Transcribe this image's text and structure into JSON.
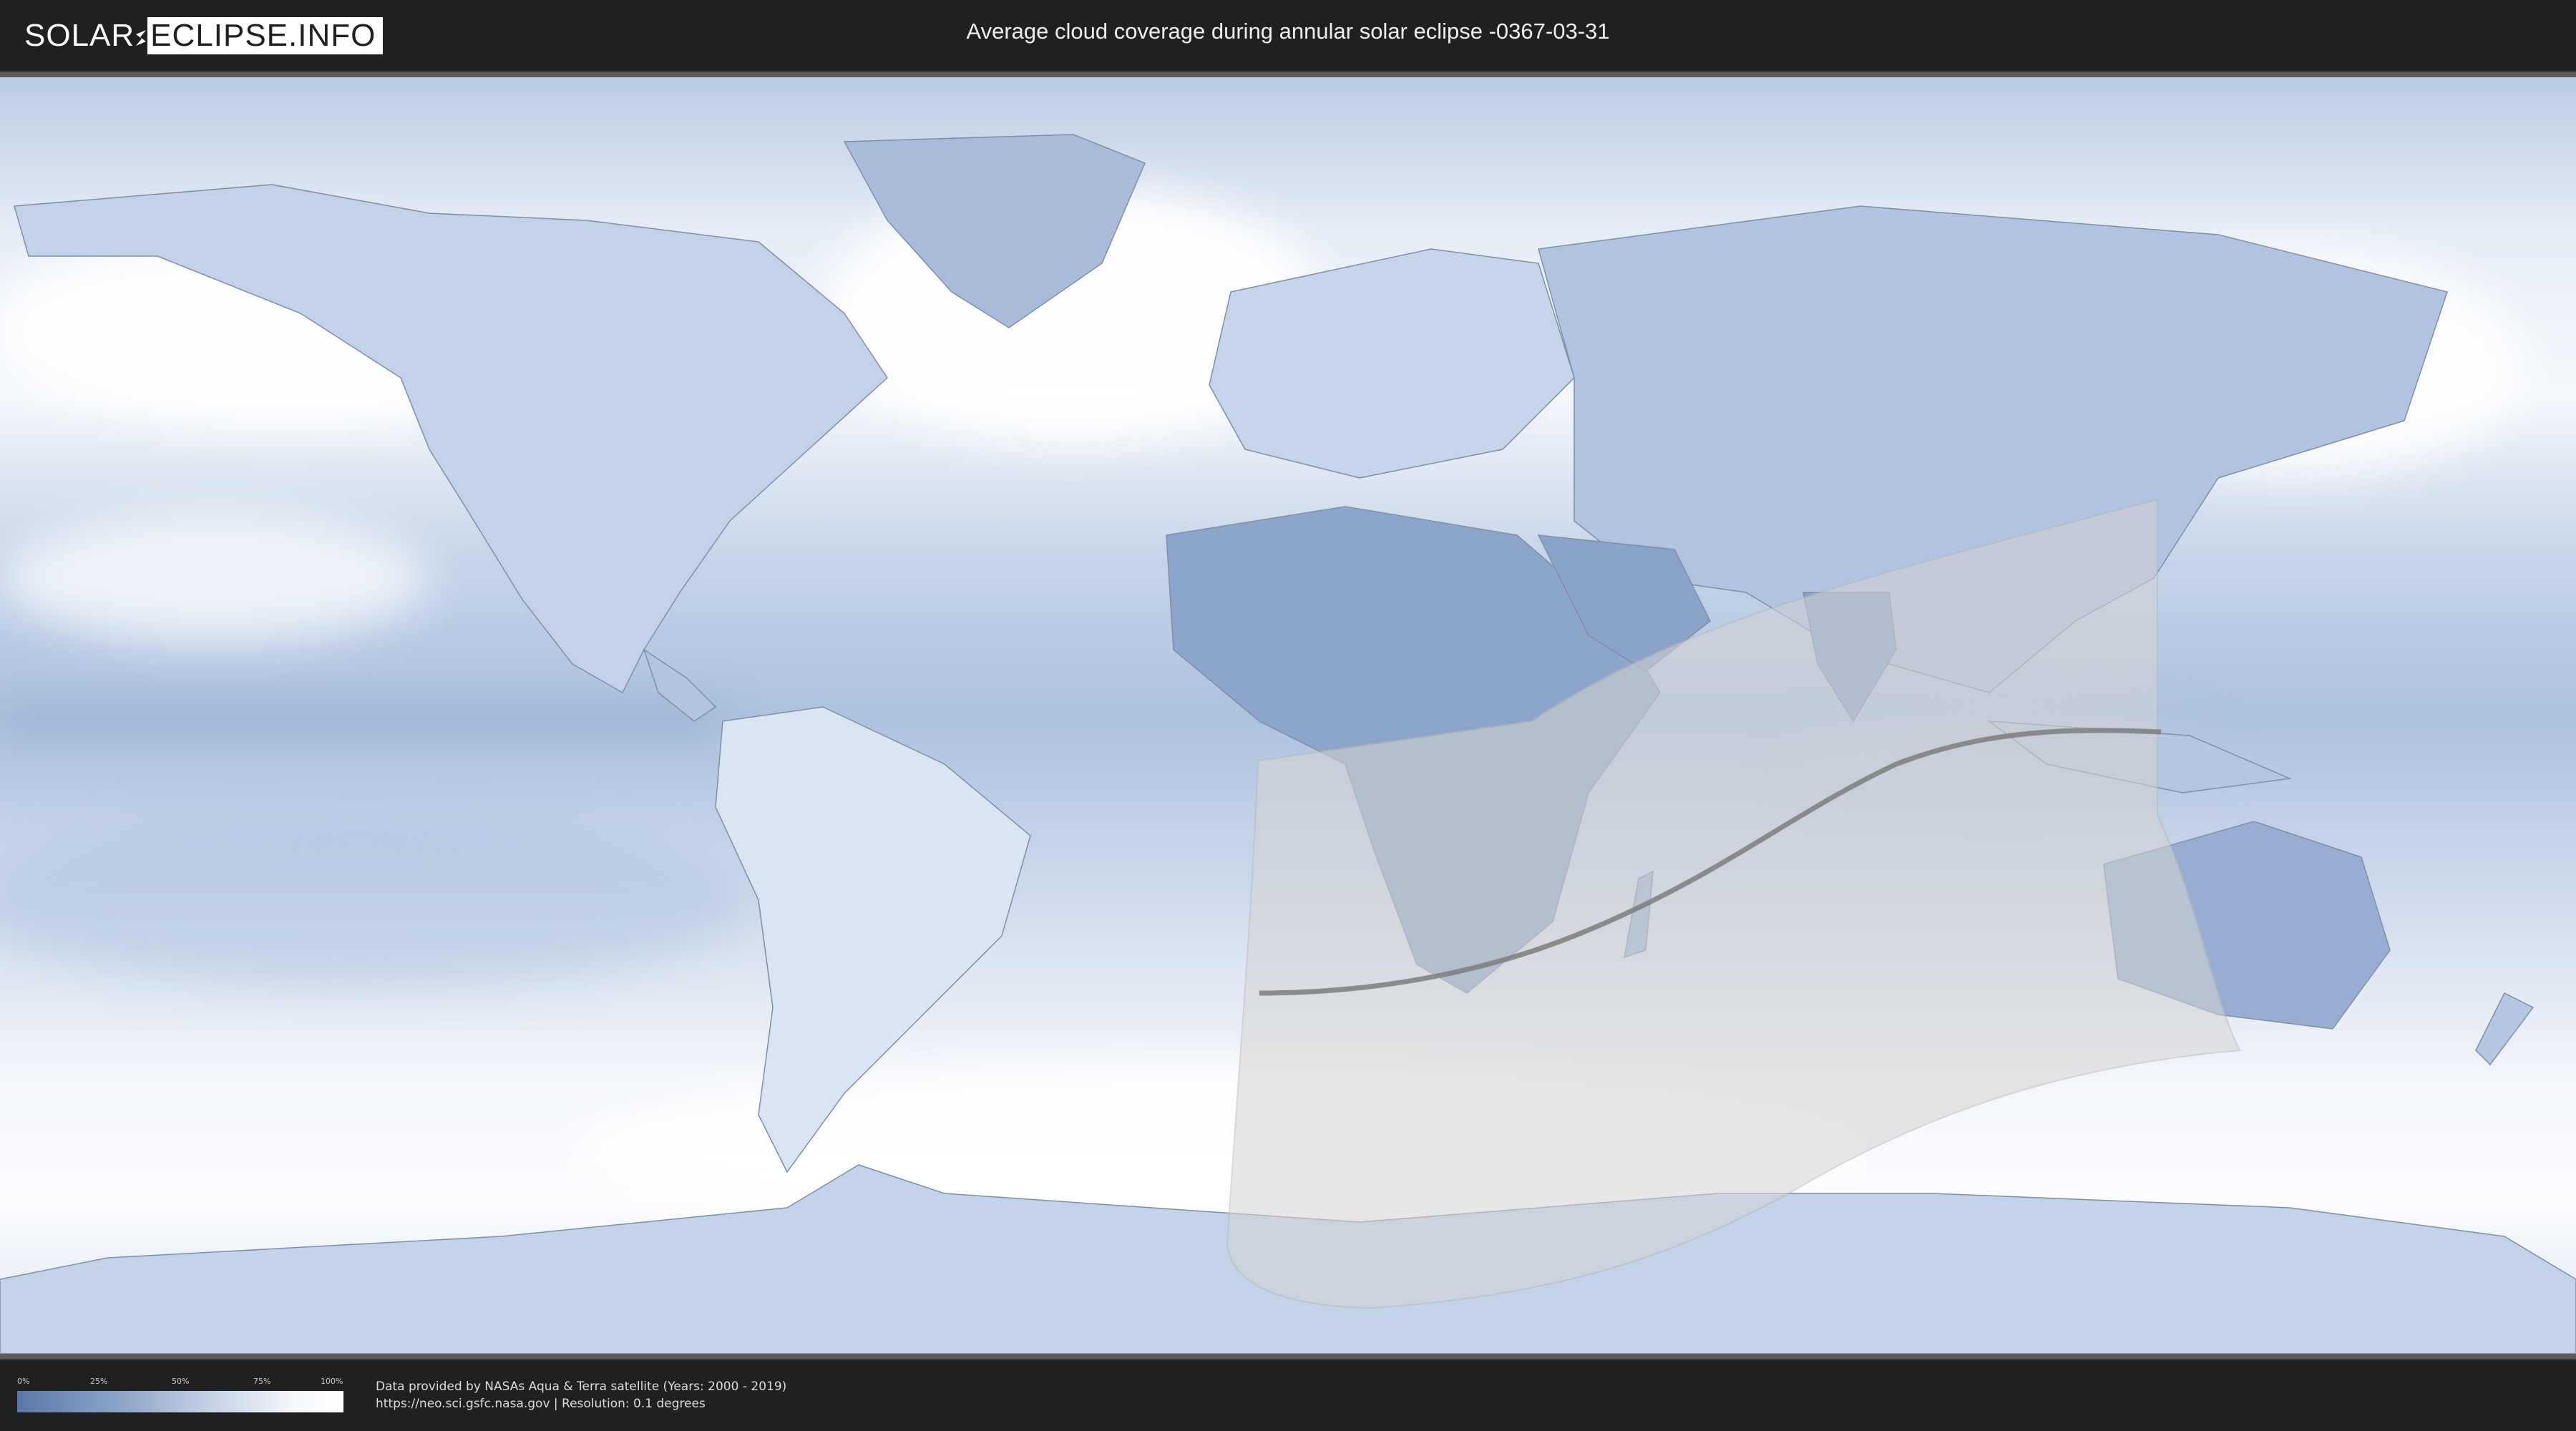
{
  "header": {
    "logo_left": "SOLAR",
    "logo_right": "ECLIPSE.INFO",
    "title": "Average cloud coverage during annular solar eclipse -0367-03-31"
  },
  "map": {
    "type": "cloud-coverage-world-map",
    "projection": "equirectangular",
    "colors": {
      "clear_sky": "#5b78a8",
      "full_cloud": "#ffffff",
      "eclipse_overlay": "#cfcfcf",
      "central_line": "#7a7a7a"
    }
  },
  "legend": {
    "ticks": [
      "0%",
      "25%",
      "50%",
      "75%",
      "100%"
    ]
  },
  "footer": {
    "credit_line1": "Data provided by NASAs Aqua & Terra satellite (Years: 2000 - 2019)",
    "credit_line2": "https://neo.sci.gsfc.nasa.gov | Resolution: 0.1 degrees"
  }
}
